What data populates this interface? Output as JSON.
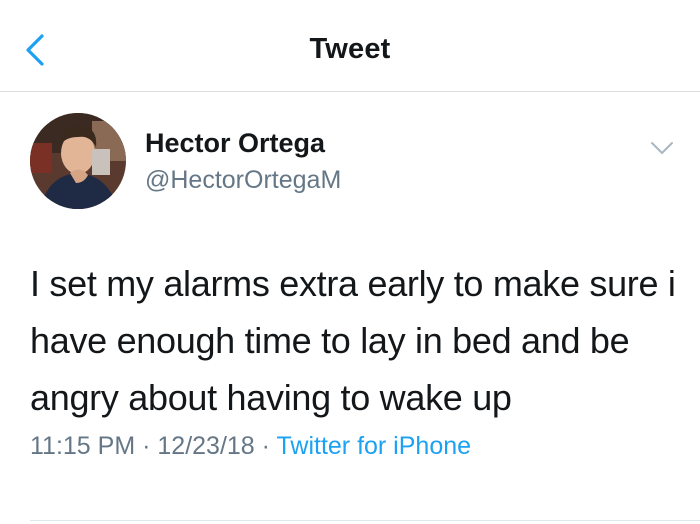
{
  "nav": {
    "back_icon": "chevron-left-icon",
    "title": "Tweet"
  },
  "tweet": {
    "author_name": "Hector Ortega",
    "author_handle": "@HectorOrtegaM",
    "text": "I set my alarms extra early to make sure i have enough time to lay in bed and be angry about having to wake up",
    "time": "11:15 PM",
    "date": "12/23/18",
    "separator": "·",
    "source": "Twitter for iPhone"
  },
  "colors": {
    "accent": "#1da1f2",
    "text": "#14171a",
    "secondary": "#657786"
  }
}
